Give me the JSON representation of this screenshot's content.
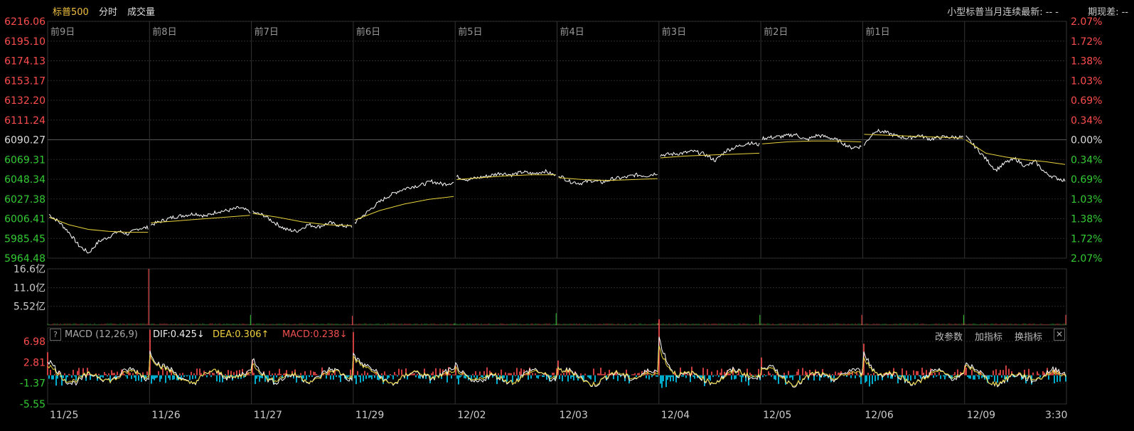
{
  "header": {
    "title": "标普500",
    "mode": "分时",
    "volume_label": "成交量",
    "latest": "小型标普当月连续最新: --  -",
    "spread": "期现差: --"
  },
  "macd_bar": {
    "name": "MACD (12,26,9)",
    "dif": "DIF:0.425↓",
    "dea": "DEA:0.306↑",
    "macd": "MACD:0.238↓",
    "btn_params": "改参数",
    "btn_add": "加指标",
    "btn_switch": "换指标",
    "help": "?",
    "close": "✕"
  },
  "colors": {
    "up": "#ff4d4d",
    "down": "#33cc33",
    "neutral": "#dddddd",
    "price_line": "#ffffff",
    "avg_line": "#e6d23c",
    "macd_up": "#ff4d4d",
    "macd_down": "#00d8ff",
    "dif_line": "#ffffff",
    "dea_line": "#e6d23c",
    "grid": "#2a2a2a"
  },
  "chart_data": [
    {
      "type": "line",
      "name": "price",
      "y_ticks_left": [
        "6216.06",
        "6195.10",
        "6174.13",
        "6153.17",
        "6132.20",
        "6111.24",
        "6090.27",
        "6069.31",
        "6048.34",
        "6027.38",
        "6006.41",
        "5985.45",
        "5964.48"
      ],
      "y_ticks_right": [
        "2.07%",
        "1.72%",
        "1.38%",
        "1.03%",
        "0.69%",
        "0.34%",
        "0.00%",
        "0.34%",
        "0.69%",
        "1.03%",
        "1.38%",
        "1.72%",
        "2.07%"
      ],
      "ylim": [
        5964.48,
        6216.06
      ],
      "baseline": 6090.27,
      "day_labels": [
        "前9日",
        "前8日",
        "前7日",
        "前6日",
        "前5日",
        "前4日",
        "前3日",
        "前2日",
        "前1日"
      ],
      "days": [
        {
          "open": 6011,
          "low": 5967,
          "close": 5997,
          "path": [
            6011,
            6003,
            5992,
            5978,
            5970,
            5982,
            5987,
            5993,
            5990,
            5996,
            5997
          ],
          "avg": [
            6008,
            6000,
            5995,
            5993,
            5992,
            5992
          ]
        },
        {
          "open": 6000,
          "low": 5998,
          "close": 6014,
          "path": [
            6000,
            6004,
            6008,
            6010,
            6012,
            6009,
            6014,
            6015,
            6018,
            6014
          ],
          "avg": [
            6002,
            6004,
            6006,
            6008,
            6010
          ]
        },
        {
          "open": 6013,
          "low": 5992,
          "close": 5998,
          "path": [
            6013,
            6010,
            6002,
            5995,
            5993,
            6000,
            5998,
            6002,
            5999,
            5998
          ],
          "avg": [
            6012,
            6008,
            6003,
            6000,
            5999
          ]
        },
        {
          "open": 6002,
          "low": 5998,
          "close": 6045,
          "path": [
            6002,
            6012,
            6022,
            6030,
            6036,
            6040,
            6042,
            6046,
            6043,
            6045
          ],
          "avg": [
            6005,
            6015,
            6022,
            6027,
            6030
          ]
        },
        {
          "open": 6051,
          "low": 6045,
          "close": 6052,
          "path": [
            6051,
            6048,
            6050,
            6052,
            6055,
            6053,
            6056,
            6054,
            6057,
            6052
          ],
          "avg": [
            6048,
            6050,
            6052,
            6053,
            6053
          ]
        },
        {
          "open": 6053,
          "low": 6041,
          "close": 6055,
          "path": [
            6053,
            6046,
            6044,
            6047,
            6045,
            6049,
            6050,
            6053,
            6052,
            6055
          ],
          "avg": [
            6050,
            6048,
            6047,
            6048,
            6049
          ]
        },
        {
          "open": 6074,
          "low": 6067,
          "close": 6087,
          "path": [
            6074,
            6075,
            6076,
            6078,
            6075,
            6068,
            6079,
            6083,
            6087,
            6085
          ],
          "avg": [
            6071,
            6073,
            6074,
            6075,
            6076
          ]
        },
        {
          "open": 6092,
          "low": 6080,
          "close": 6083,
          "path": [
            6092,
            6093,
            6094,
            6096,
            6090,
            6095,
            6093,
            6089,
            6082,
            6083
          ],
          "avg": [
            6086,
            6088,
            6089,
            6089,
            6088
          ]
        },
        {
          "open": 6085,
          "low": 6082,
          "close": 6093,
          "path": [
            6085,
            6100,
            6098,
            6094,
            6092,
            6095,
            6091,
            6093,
            6093,
            6093
          ],
          "avg": [
            6096,
            6095,
            6094,
            6093,
            6092
          ]
        },
        {
          "open": 6093,
          "low": 6044,
          "close": 6047,
          "path": [
            6093,
            6082,
            6070,
            6058,
            6066,
            6070,
            6062,
            6067,
            6055,
            6050,
            6047
          ],
          "avg": [
            6090,
            6076,
            6072,
            6069,
            6067,
            6064
          ]
        }
      ]
    },
    {
      "type": "bar",
      "name": "volume",
      "y_ticks": [
        "16.6亿",
        "11.0亿",
        "5.52亿"
      ],
      "ylim": [
        0,
        16.6
      ]
    },
    {
      "type": "line",
      "name": "MACD",
      "y_ticks": [
        "6.98",
        "2.81",
        "-1.37",
        "-5.55"
      ],
      "ylim": [
        -5.55,
        6.98
      ],
      "x_labels": [
        "11/25",
        "11/26",
        "11/27",
        "11/29",
        "12/02",
        "12/03",
        "12/04",
        "12/05",
        "12/06",
        "12/09",
        "3:30"
      ],
      "spikes": [
        2.5,
        6.5,
        3.0,
        5.5,
        1.5,
        2.0,
        7.0,
        2.5,
        5.5,
        2.0
      ]
    }
  ]
}
